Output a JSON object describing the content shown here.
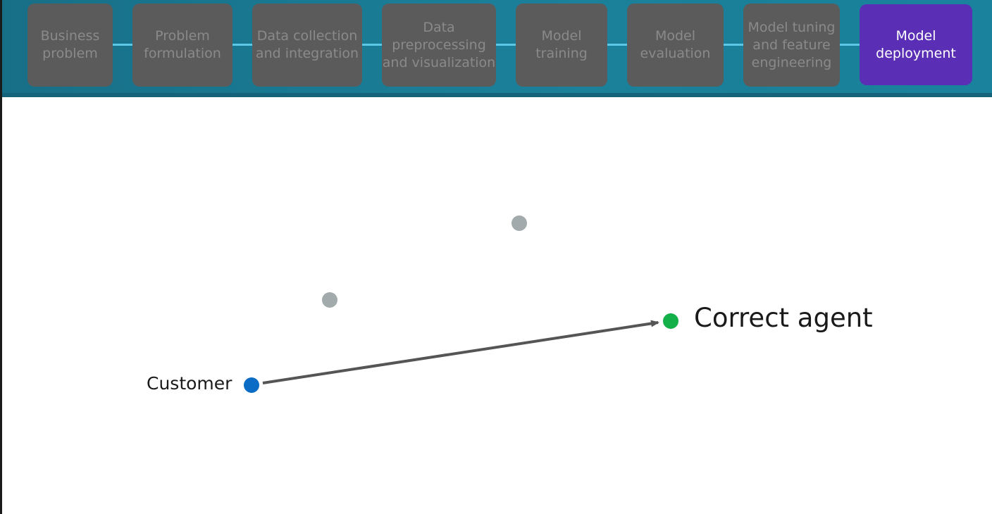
{
  "pipeline": {
    "steps": [
      {
        "label": "Business\nproblem",
        "active": false
      },
      {
        "label": "Problem\nformulation",
        "active": false
      },
      {
        "label": "Data collection\nand integration",
        "active": false
      },
      {
        "label": "Data\npreprocessing\nand visualization",
        "active": false
      },
      {
        "label": "Model\ntraining",
        "active": false
      },
      {
        "label": "Model\nevaluation",
        "active": false
      },
      {
        "label": "Model tuning\nand feature\nengineering",
        "active": false
      },
      {
        "label": "Model\ndeployment",
        "active": true
      }
    ]
  },
  "diagram": {
    "customer_label": "Customer",
    "agent_label": "Correct agent",
    "colors": {
      "customer": "#0a6cc4",
      "agent": "#13b04a",
      "other": "#a2aaab",
      "arrow": "#555555",
      "active_step": "#5a2fb5",
      "inactive_step": "#5b5b5b",
      "connector": "#5cc8e6"
    }
  }
}
